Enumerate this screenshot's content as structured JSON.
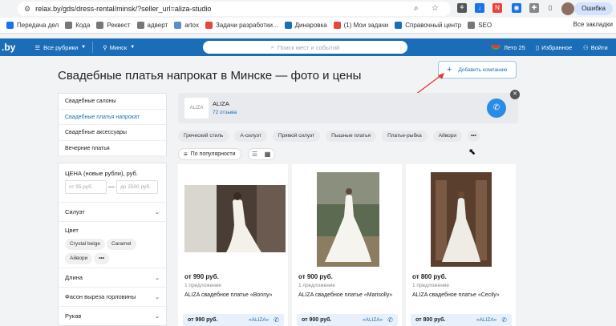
{
  "browser": {
    "url": "relax.by/gds/dress-rental/minsk/?seller_url=aliza-studio",
    "profile_status": "Ошибка",
    "bookmarks": [
      {
        "label": "Передача дел",
        "color": "#1a73e8"
      },
      {
        "label": "Кода",
        "color": "#777777"
      },
      {
        "label": "Реквест",
        "color": "#777777"
      },
      {
        "label": "адверт",
        "color": "#777777"
      },
      {
        "label": "artox",
        "color": "#5f8bc9"
      },
      {
        "label": "Задачи разработки...",
        "color": "#e8453c"
      },
      {
        "label": "Динаровка",
        "color": "#1b6db7"
      },
      {
        "label": "(1) Мои задачи",
        "color": "#e8453c"
      },
      {
        "label": "Справочный центр",
        "color": "#1b6db7"
      },
      {
        "label": "SEO",
        "color": "#777777"
      }
    ],
    "all_bookmarks": "Все закладки"
  },
  "header": {
    "logo": ".by",
    "rubrics": "Все рубрики",
    "city": "Минск",
    "search_placeholder": "Поиск мест и событий",
    "promo": "Лето 25",
    "favorites": "Избранное",
    "login": "Войти",
    "brand_color": "#1b6db7"
  },
  "page": {
    "title": "Свадебные платья напрокат в Минске — фото и цены",
    "add_company": "Добавить компанию"
  },
  "sidebar": {
    "categories": [
      {
        "label": "Свадебные салоны",
        "active": false
      },
      {
        "label": "Свадебные платья напрокат",
        "active": true
      },
      {
        "label": "Свадебные аксессуары",
        "active": false
      },
      {
        "label": "Вечерние платья",
        "active": false
      }
    ],
    "price_label": "ЦЕНА (новые рубли), руб.",
    "price_from": "от 95 руб.",
    "price_to": "до 2500 руб.",
    "silhouette": "Силуэт",
    "color_label": "Цвет",
    "colors": [
      "Crystal beige",
      "Caramel",
      "Айвори"
    ],
    "length": "Длина",
    "neckline": "Фасон выреза горловины",
    "sleeves": "Рукав"
  },
  "company": {
    "name": "ALIZA",
    "reviews": "72 отзыва",
    "logo_text": "ALIZA"
  },
  "tags": [
    "Греческий стиль",
    "А-силуэт",
    "Прямой силуэт",
    "Пышные платья",
    "Платье-рыбка",
    "Айвори"
  ],
  "sort": {
    "label": "По популярности"
  },
  "products": [
    {
      "price": "от 990 руб.",
      "offers": "1 предложение",
      "name": "ALIZA свадебное платье «Bonny»",
      "offer_price": "от 990 руб.",
      "offer_seller": "«ALIZA»"
    },
    {
      "price": "от 900 руб.",
      "offers": "1 предложение",
      "name": "ALIZA свадебное платье «Marisolly»",
      "offer_price": "от 900 руб.",
      "offer_seller": "«ALIZA»"
    },
    {
      "price": "от 800 руб.",
      "offers": "1 предложение",
      "name": "ALIZA свадебное платье «Cecily»",
      "offer_price": "от 800 руб.",
      "offer_seller": "«ALIZA»"
    }
  ]
}
